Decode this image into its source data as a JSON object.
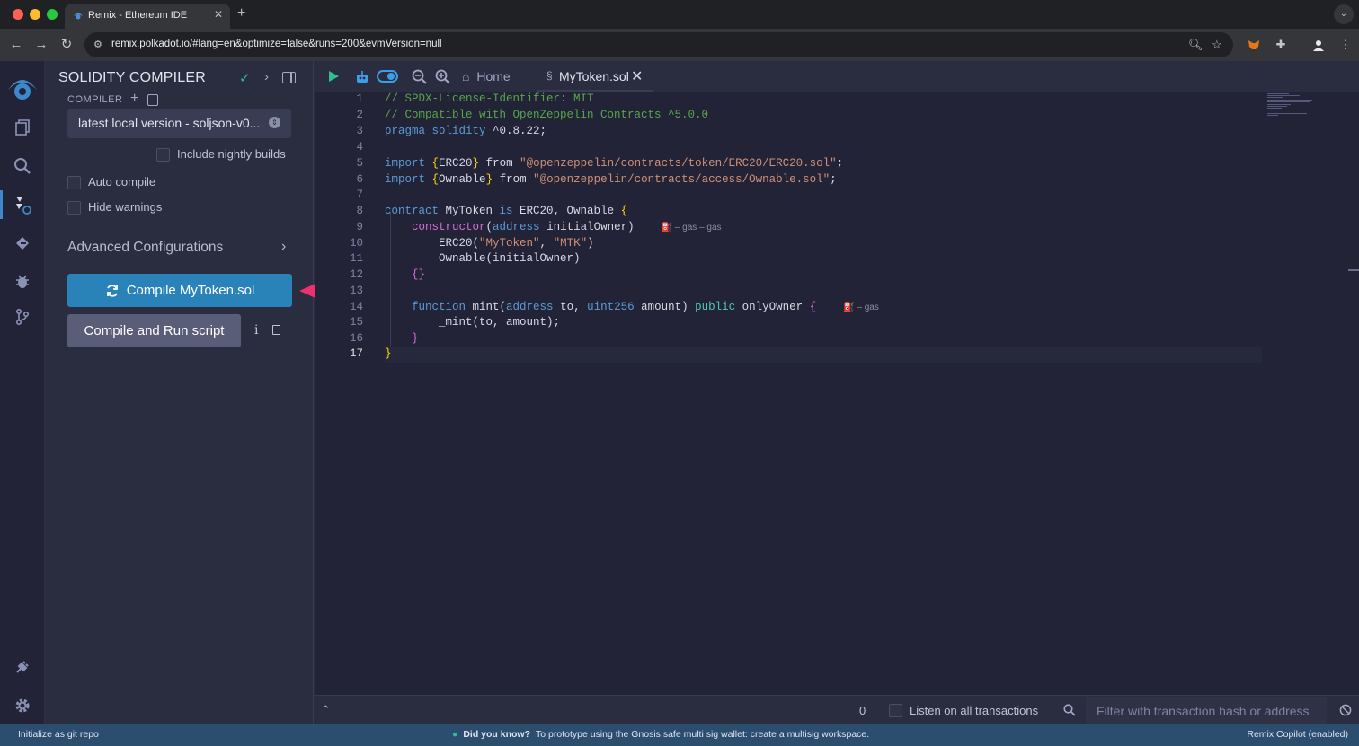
{
  "browser": {
    "tab_title": "Remix - Ethereum IDE",
    "tab_close": "✕",
    "new_tab": "+",
    "tab_menu": "⌄",
    "url": "remix.polkadot.io/#lang=en&optimize=false&runs=200&evmVersion=null"
  },
  "side_panel": {
    "title": "SOLIDITY COMPILER",
    "compiler_label": "COMPILER",
    "version_value": "latest local version - soljson-v0...",
    "include_nightly_label": "Include nightly builds",
    "auto_compile_label": "Auto compile",
    "hide_warnings_label": "Hide warnings",
    "advanced_config_label": "Advanced Configurations",
    "compile_button_label": "Compile MyToken.sol",
    "run_script_button_label": "Compile and Run script",
    "include_nightly_checked": false,
    "auto_compile_checked": false,
    "hide_warnings_checked": false
  },
  "editor": {
    "home_tab_label": "Home",
    "file_tab_label": "MyToken.sol",
    "active_line": 17,
    "gas_hint_1": "⛽ – gas – gas",
    "gas_hint_2": "⛽ – gas",
    "line_numbers": [
      "1",
      "2",
      "3",
      "4",
      "5",
      "6",
      "7",
      "8",
      "9",
      "10",
      "11",
      "12",
      "13",
      "14",
      "15",
      "16",
      "17"
    ],
    "code_lines": [
      "// SPDX-License-Identifier: MIT",
      "// Compatible with OpenZeppelin Contracts ^5.0.0",
      "pragma solidity ^0.8.22;",
      "",
      "import {ERC20} from \"@openzeppelin/contracts/token/ERC20/ERC20.sol\";",
      "import {Ownable} from \"@openzeppelin/contracts/access/Ownable.sol\";",
      "",
      "contract MyToken is ERC20, Ownable {",
      "    constructor(address initialOwner)",
      "        ERC20(\"MyToken\", \"MTK\")",
      "        Ownable(initialOwner)",
      "    {}",
      "",
      "    function mint(address to, uint256 amount) public onlyOwner {",
      "        _mint(to, amount);",
      "    }",
      "}"
    ]
  },
  "terminal": {
    "pending_count": "0",
    "listen_label": "Listen on all transactions",
    "filter_placeholder": "Filter with transaction hash or address"
  },
  "status_bar": {
    "left_text": "Initialize as git repo",
    "tip_prefix": "Did you know?",
    "tip_text": "To prototype using the Gnosis safe multi sig wallet: create a multisig workspace.",
    "right_text": "Remix Copilot (enabled)"
  },
  "colors": {
    "accent": "#2a83b8",
    "annotation_arrow": "#f0306e",
    "status_bar": "#2b4d6e"
  }
}
